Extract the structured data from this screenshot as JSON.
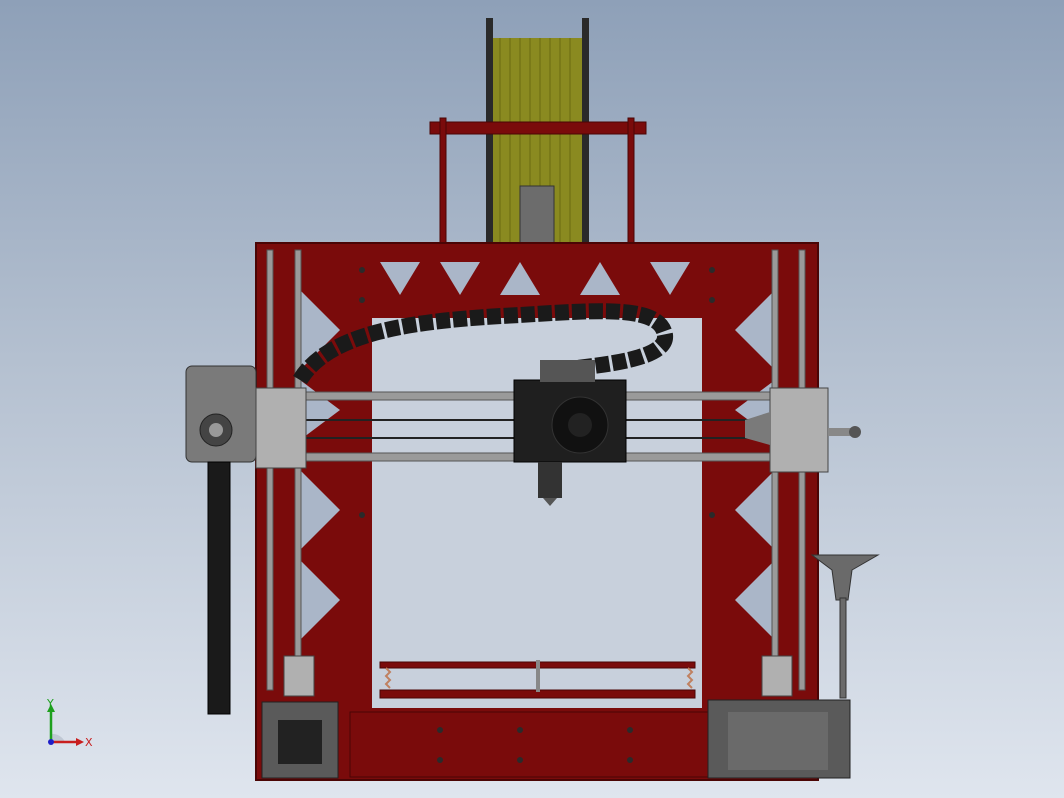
{
  "viewport": {
    "background_top": "#8ea0b8",
    "background_bottom": "#dfe5ee"
  },
  "model": {
    "frame_color": "#7a0b0b",
    "frame_edge_color": "#4a0505",
    "filament_color": "#8a8a20",
    "metal_color": "#9a9a9a",
    "dark_part_color": "#1a1a1a",
    "motor_color": "#5a5a5a"
  },
  "triad": {
    "x_label": "X",
    "y_label": "Y",
    "x_color": "#c81e1e",
    "y_color": "#1ea01e",
    "z_color": "#1e1ec8"
  }
}
